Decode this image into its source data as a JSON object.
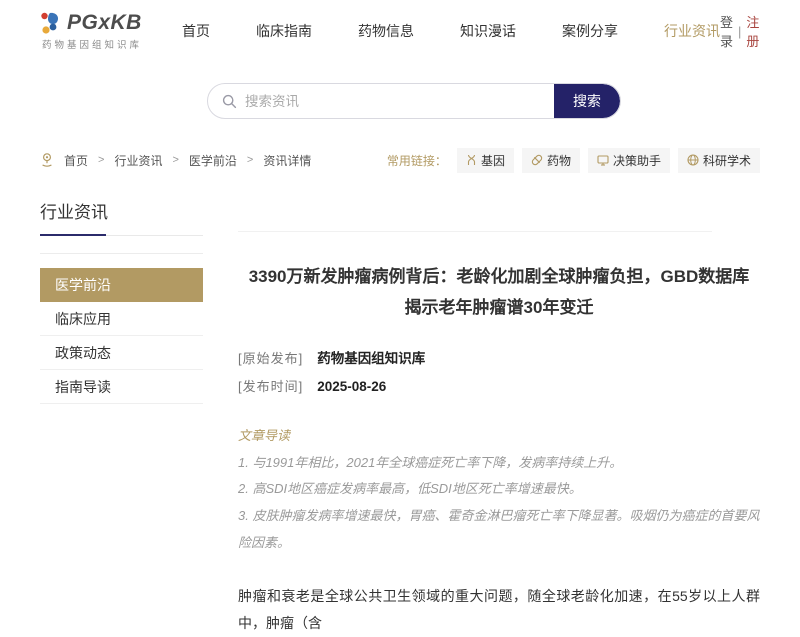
{
  "brand": {
    "name": "PGxKB",
    "tagline": "药物基因组知识库"
  },
  "nav": {
    "items": [
      {
        "label": "首页"
      },
      {
        "label": "临床指南"
      },
      {
        "label": "药物信息"
      },
      {
        "label": "知识漫话"
      },
      {
        "label": "案例分享"
      },
      {
        "label": "行业资讯"
      }
    ],
    "login": "登录",
    "divider": "|",
    "register": "注册"
  },
  "search": {
    "placeholder": "搜索资讯",
    "button": "搜索"
  },
  "breadcrumb": {
    "separator": ">",
    "items": [
      {
        "label": "首页"
      },
      {
        "label": "行业资讯"
      },
      {
        "label": "医学前沿"
      },
      {
        "label": "资讯详情"
      }
    ]
  },
  "quick_links": {
    "label": "常用链接：",
    "items": [
      {
        "label": "基因",
        "icon": "dna-icon"
      },
      {
        "label": "药物",
        "icon": "pill-icon"
      },
      {
        "label": "决策助手",
        "icon": "monitor-icon"
      },
      {
        "label": "科研学术",
        "icon": "globe-icon"
      }
    ]
  },
  "sidebar": {
    "title": "行业资讯",
    "items": [
      {
        "label": "医学前沿",
        "active": true
      },
      {
        "label": "临床应用",
        "active": false
      },
      {
        "label": "政策动态",
        "active": false
      },
      {
        "label": "指南导读",
        "active": false
      }
    ]
  },
  "article": {
    "title": "3390万新发肿瘤病例背后：老龄化加剧全球肿瘤负担，GBD数据库揭示老年肿瘤谱30年变迁",
    "meta": [
      {
        "label": "[原始发布]",
        "value": "药物基因组知识库"
      },
      {
        "label": "[发布时间]",
        "value": "2025-08-26"
      }
    ],
    "digest": {
      "title": "文章导读",
      "lines": [
        "1. 与1991年相比，2021年全球癌症死亡率下降，发病率持续上升。",
        "2. 高SDI地区癌症发病率最高，低SDI地区死亡率增速最快。",
        "3. 皮肤肿瘤发病率增速最快，胃癌、霍奇金淋巴瘤死亡率下降显著。吸烟仍为癌症的首要风险因素。"
      ]
    },
    "body": "肿瘤和衰老是全球公共卫生领域的重大问题，随全球老龄化加速，在55岁以上人群中，肿瘤（含"
  },
  "colors": {
    "gold": "#b29a63",
    "navy": "#242268",
    "register_red": "#a8453f"
  }
}
